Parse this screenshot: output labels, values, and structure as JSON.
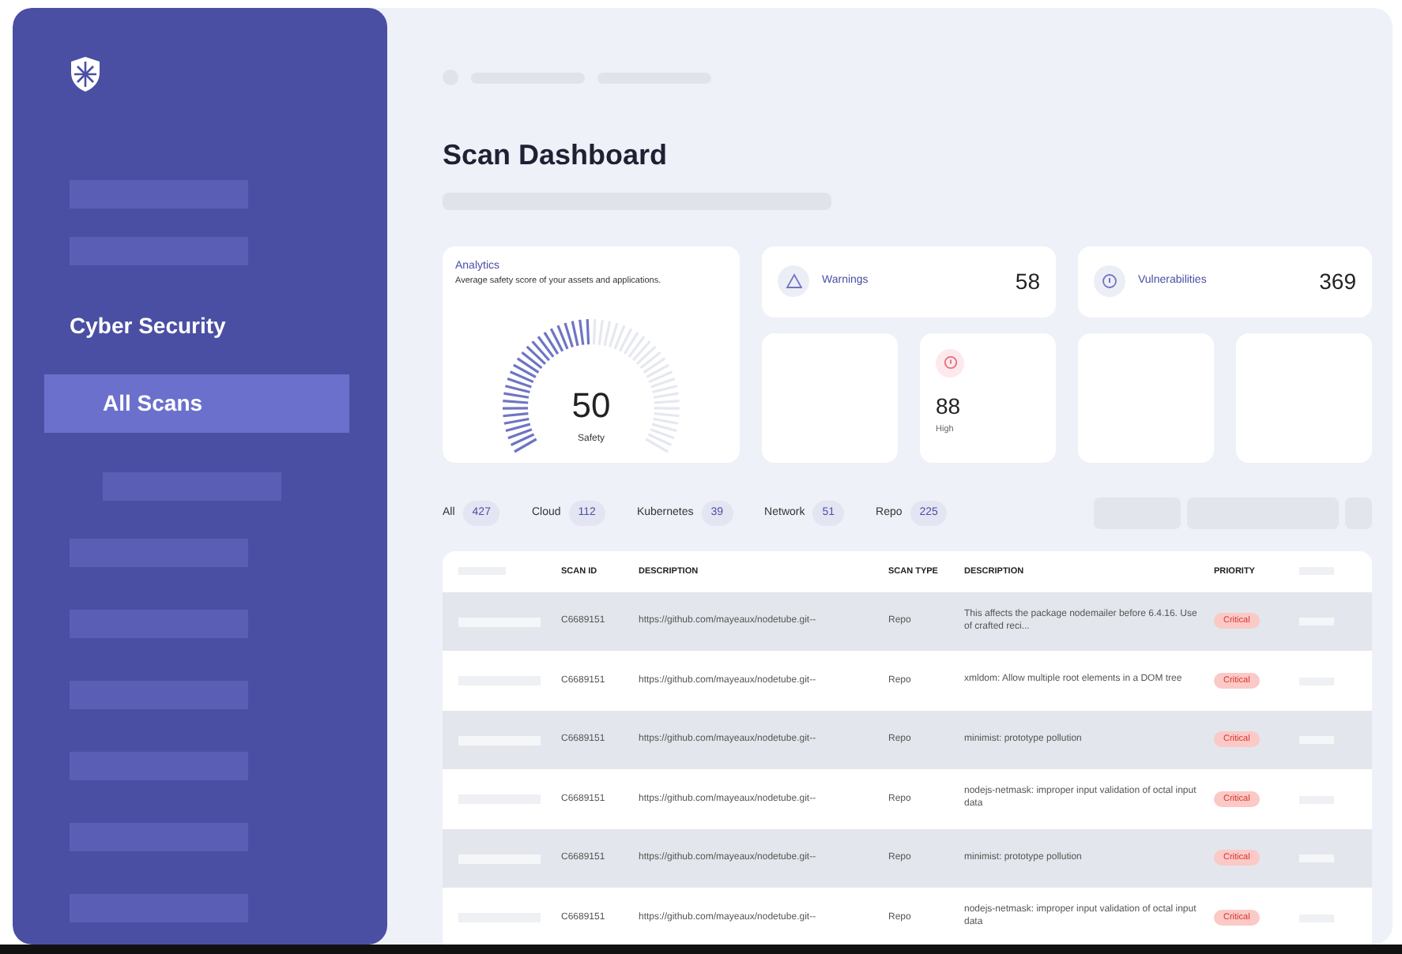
{
  "sidebar": {
    "section": "Cyber Security",
    "items": [
      {
        "label": "All Scans",
        "selected": true
      }
    ]
  },
  "page": {
    "title": "Scan Dashboard"
  },
  "analytics": {
    "title": "Analytics",
    "subtitle": "Average safety score of your assets and applications.",
    "value": "50",
    "label": "Safety"
  },
  "stats": [
    {
      "label": "Warnings",
      "value": "58",
      "kind": "warning"
    },
    {
      "label": "Vulnerabilities",
      "value": "369",
      "kind": "info"
    }
  ],
  "severity": [
    {
      "kind": "empty"
    },
    {
      "kind": "high",
      "value": "88",
      "label": "High"
    },
    {
      "kind": "empty"
    },
    {
      "kind": "empty"
    }
  ],
  "filters": [
    {
      "label": "All",
      "count": "427"
    },
    {
      "label": "Cloud",
      "count": "112"
    },
    {
      "label": "Kubernetes",
      "count": "39"
    },
    {
      "label": "Network",
      "count": "51"
    },
    {
      "label": "Repo",
      "count": "225"
    }
  ],
  "table": {
    "columns": [
      "SCAN ID",
      "DESCRIPTION",
      "SCAN TYPE",
      "DESCRIPTION",
      "PRIORITY"
    ],
    "rows": [
      {
        "id": "C6689151",
        "url": "https://github.com/mayeaux/nodetube.git--",
        "type": "Repo",
        "description": "This affects the package nodemailer before 6.4.16. Use of crafted reci...",
        "priority": "Critical"
      },
      {
        "id": "C6689151",
        "url": "https://github.com/mayeaux/nodetube.git--",
        "type": "Repo",
        "description": "xmldom: Allow multiple root elements in a DOM tree",
        "priority": "Critical"
      },
      {
        "id": "C6689151",
        "url": "https://github.com/mayeaux/nodetube.git--",
        "type": "Repo",
        "description": "minimist: prototype pollution",
        "priority": "Critical"
      },
      {
        "id": "C6689151",
        "url": "https://github.com/mayeaux/nodetube.git--",
        "type": "Repo",
        "description": "nodejs-netmask: improper input validation of octal input data",
        "priority": "Critical"
      },
      {
        "id": "C6689151",
        "url": "https://github.com/mayeaux/nodetube.git--",
        "type": "Repo",
        "description": "minimist: prototype pollution",
        "priority": "Critical"
      },
      {
        "id": "C6689151",
        "url": "https://github.com/mayeaux/nodetube.git--",
        "type": "Repo",
        "description": "nodejs-netmask: improper input validation of octal input data",
        "priority": "Critical"
      }
    ]
  }
}
